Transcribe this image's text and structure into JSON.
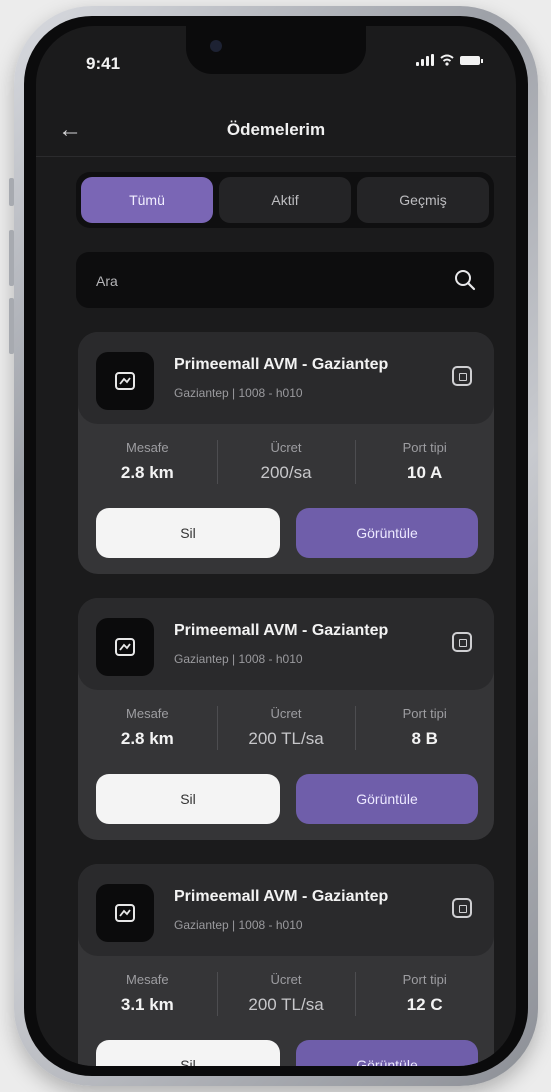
{
  "status_bar": {
    "time": "9:41"
  },
  "header": {
    "back_icon": "arrow-left-icon",
    "title": "Ödemelerim"
  },
  "tabs": [
    {
      "label": "Tümü",
      "active": true
    },
    {
      "label": "Aktif",
      "active": false
    },
    {
      "label": "Geçmiş",
      "active": false
    }
  ],
  "search": {
    "placeholder": "Ara",
    "icon": "search-icon"
  },
  "colors": {
    "accent": "#7a66b5",
    "card": "#353537",
    "background": "#1b1b1c"
  },
  "cards": [
    {
      "name": "Primeemall AVM - Gaziantep",
      "sub": "Gaziantep | 1008 - h010",
      "stats": [
        {
          "label": "Mesafe",
          "value": "2.8 km"
        },
        {
          "label": "Ücret",
          "value": "200/sa"
        },
        {
          "label": "Port tipi",
          "value": "10 A"
        }
      ],
      "btn_left": "Sil",
      "btn_right": "Görüntüle"
    },
    {
      "name": "Primeemall AVM - Gaziantep",
      "sub": "Gaziantep | 1008 - h010",
      "stats": [
        {
          "label": "Mesafe",
          "value": "2.8 km"
        },
        {
          "label": "Ücret",
          "value": "200 TL/sa"
        },
        {
          "label": "Port tipi",
          "value": "8 B"
        }
      ],
      "btn_left": "Sil",
      "btn_right": "Görüntüle"
    },
    {
      "name": "Primeemall AVM - Gaziantep",
      "sub": "Gaziantep | 1008 - h010",
      "stats": [
        {
          "label": "Mesafe",
          "value": "3.1 km"
        },
        {
          "label": "Ücret",
          "value": "200 TL/sa"
        },
        {
          "label": "Port tipi",
          "value": "12 C"
        }
      ],
      "btn_left": "Sil",
      "btn_right": "Görüntüle"
    }
  ]
}
